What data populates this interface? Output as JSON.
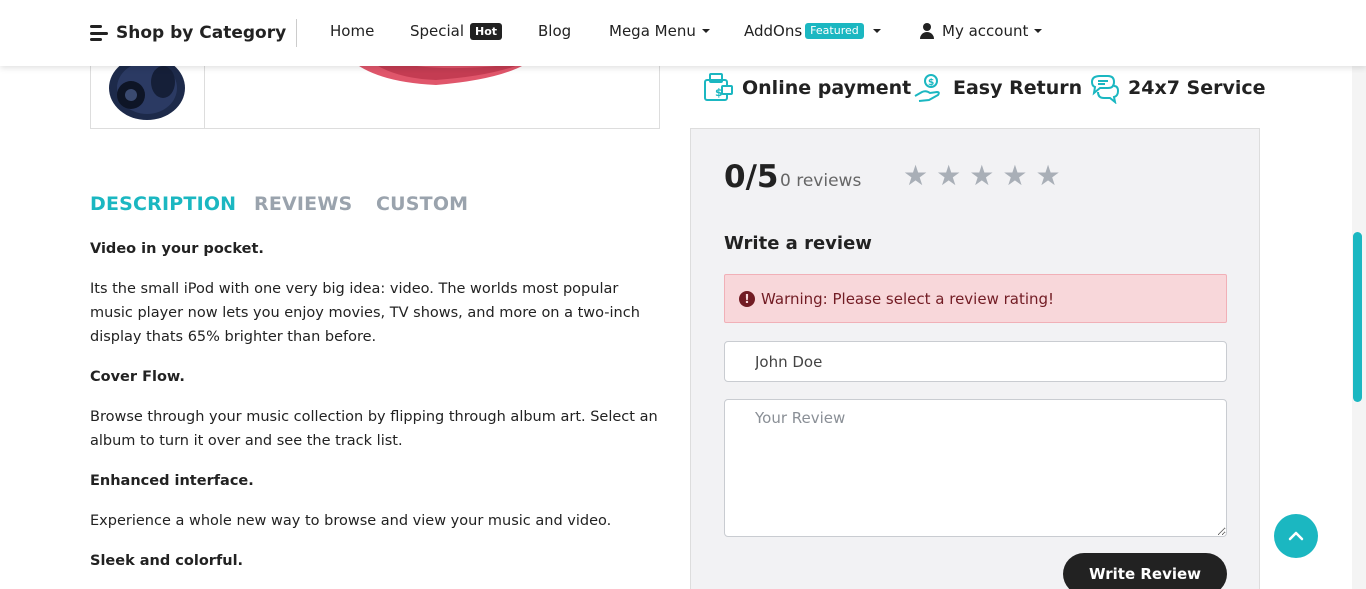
{
  "nav": {
    "category": "Shop by Category",
    "home": "Home",
    "special": "Special",
    "special_badge": "Hot",
    "blog": "Blog",
    "mega_menu": "Mega Menu",
    "addons": "AddOns",
    "addons_badge": "Featured",
    "account": "My account"
  },
  "features": [
    {
      "label": "Online payment",
      "icon": "payment-icon"
    },
    {
      "label": "Easy Return",
      "icon": "return-icon"
    },
    {
      "label": "24x7 Service",
      "icon": "chat-icon"
    }
  ],
  "tabs": [
    "DESCRIPTION",
    "REVIEWS",
    "CUSTOM"
  ],
  "description": {
    "h1": "Video in your pocket.",
    "p1": "Its the small iPod with one very big idea: video. The worlds most popular music player now lets you enjoy movies, TV shows, and more on a two-inch display thats 65% brighter than before.",
    "h2": "Cover Flow.",
    "p2": "Browse through your music collection by flipping through album art. Select an album to turn it over and see the track list.",
    "h3": "Enhanced interface.",
    "p3": "Experience a whole new way to browse and view your music and video.",
    "h4": "Sleek and colorful."
  },
  "review": {
    "score": "0/5",
    "count": "0 reviews",
    "rating_stars": 5,
    "write_title": "Write a review",
    "warning": "Warning: Please select a review rating!",
    "name_value": "John Doe",
    "review_placeholder": "Your Review",
    "submit": "Write Review"
  },
  "colors": {
    "accent": "#1bb7c1",
    "alert_bg": "#f8d7da",
    "alert_text": "#721c24"
  }
}
